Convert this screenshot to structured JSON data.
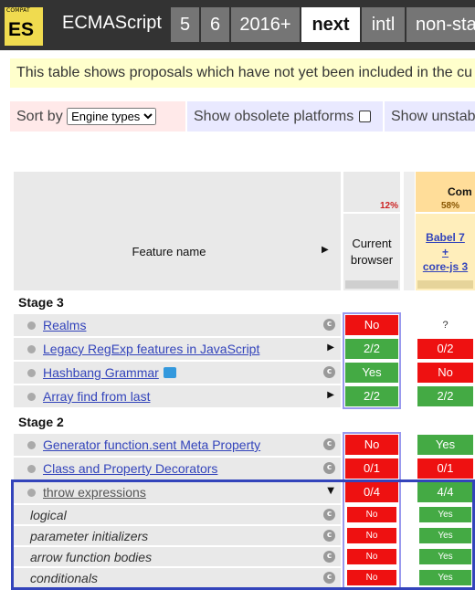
{
  "header": {
    "logo_small": "COMPAT",
    "logo_big": "ES",
    "title": "ECMAScript",
    "tabs": [
      {
        "label": "5",
        "active": false
      },
      {
        "label": "6",
        "active": false
      },
      {
        "label": "2016+",
        "active": false
      },
      {
        "label": "next",
        "active": true
      },
      {
        "label": "intl",
        "active": false
      },
      {
        "label": "non-sta",
        "active": false
      }
    ]
  },
  "notice": "This table shows proposals which have not yet been included in the cu",
  "options": {
    "sort_label": "Sort by",
    "sort_value": "Engine types",
    "obsolete_label": "Show obsolete platforms",
    "unstable_label": "Show unstab"
  },
  "table": {
    "compilers_label": "Com",
    "compilers_pct": "58%",
    "current_pct": "12%",
    "feature_header": "Feature name",
    "current_header": "Current browser",
    "babel_header_line1": "Babel 7",
    "babel_header_line2": "+",
    "babel_header_line3": "core-js 3",
    "stage3": "Stage 3",
    "stage2": "Stage 2",
    "rows": [
      {
        "name": "Realms",
        "current": "No",
        "babel": "?"
      },
      {
        "name": "Legacy RegExp features in JavaScript",
        "current": "2/2",
        "babel": "0/2"
      },
      {
        "name": "Hashbang Grammar",
        "current": "Yes",
        "babel": "No"
      },
      {
        "name": "Array find from last",
        "current": "2/2",
        "babel": "2/2"
      },
      {
        "name": "Generator function.sent Meta Property",
        "current": "No",
        "babel": "Yes"
      },
      {
        "name": "Class and Property Decorators",
        "current": "0/1",
        "babel": "0/1"
      },
      {
        "name": "throw expressions",
        "current": "0/4",
        "babel": "4/4"
      }
    ],
    "subrows": [
      {
        "name": "logical",
        "current": "No",
        "babel": "Yes"
      },
      {
        "name": "parameter initializers",
        "current": "No",
        "babel": "Yes"
      },
      {
        "name": "arrow function bodies",
        "current": "No",
        "babel": "Yes"
      },
      {
        "name": "conditionals",
        "current": "No",
        "babel": "Yes"
      }
    ],
    "c_icon": "c",
    "arrow_right": "▶",
    "arrow_down": "▼"
  },
  "colors": {
    "no": "#ee1111",
    "yes": "#44aa44",
    "highlight": "#3344bb"
  }
}
